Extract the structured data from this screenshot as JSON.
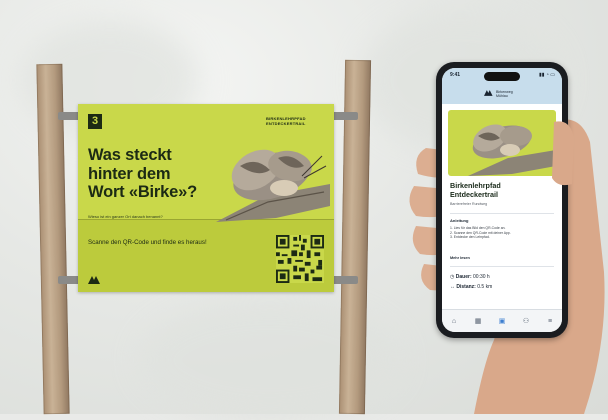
{
  "sign": {
    "number": "3",
    "corner_text": "BIRKENLEHRPFAD ENTDECKERTRAIL",
    "headline": "Was steckt\nhinter dem\nWort «Birke»?",
    "subline": "Wieso ist ein ganzer Ort danach benannt?",
    "cta": "Scanne den QR-Code und finde es heraus!"
  },
  "phone": {
    "status_time": "9:41",
    "status_icons": "▮▮ ◔ ▭",
    "app_logo_text": "Birkenweg\nMühlau",
    "page_title": "Birkenlehrpfad\nEntdeckertrail",
    "page_subtitle": "Barrierefreier Rundweg",
    "section_heading": "Anleitung",
    "section_body": "1. Lies für das Bild den QR-Code an.\n2. Scanne den QR-Code mit deiner App.\n3. Entdecke den Lehrpfad.",
    "link_text": "Mehr lesen",
    "duration_label": "Dauer:",
    "duration_value": "00:30 h",
    "distance_label": "Distanz:",
    "distance_value": "0.5 km",
    "tabs": [
      "home-icon",
      "calendar-icon",
      "map-icon",
      "people-icon",
      "menu-icon"
    ]
  },
  "colors": {
    "sign_green": "#c9d84a",
    "sign_dark": "#1c2a14",
    "app_header": "#c7ddec",
    "phone_body": "#1a1c20",
    "tab_active": "#3d7fd0"
  }
}
